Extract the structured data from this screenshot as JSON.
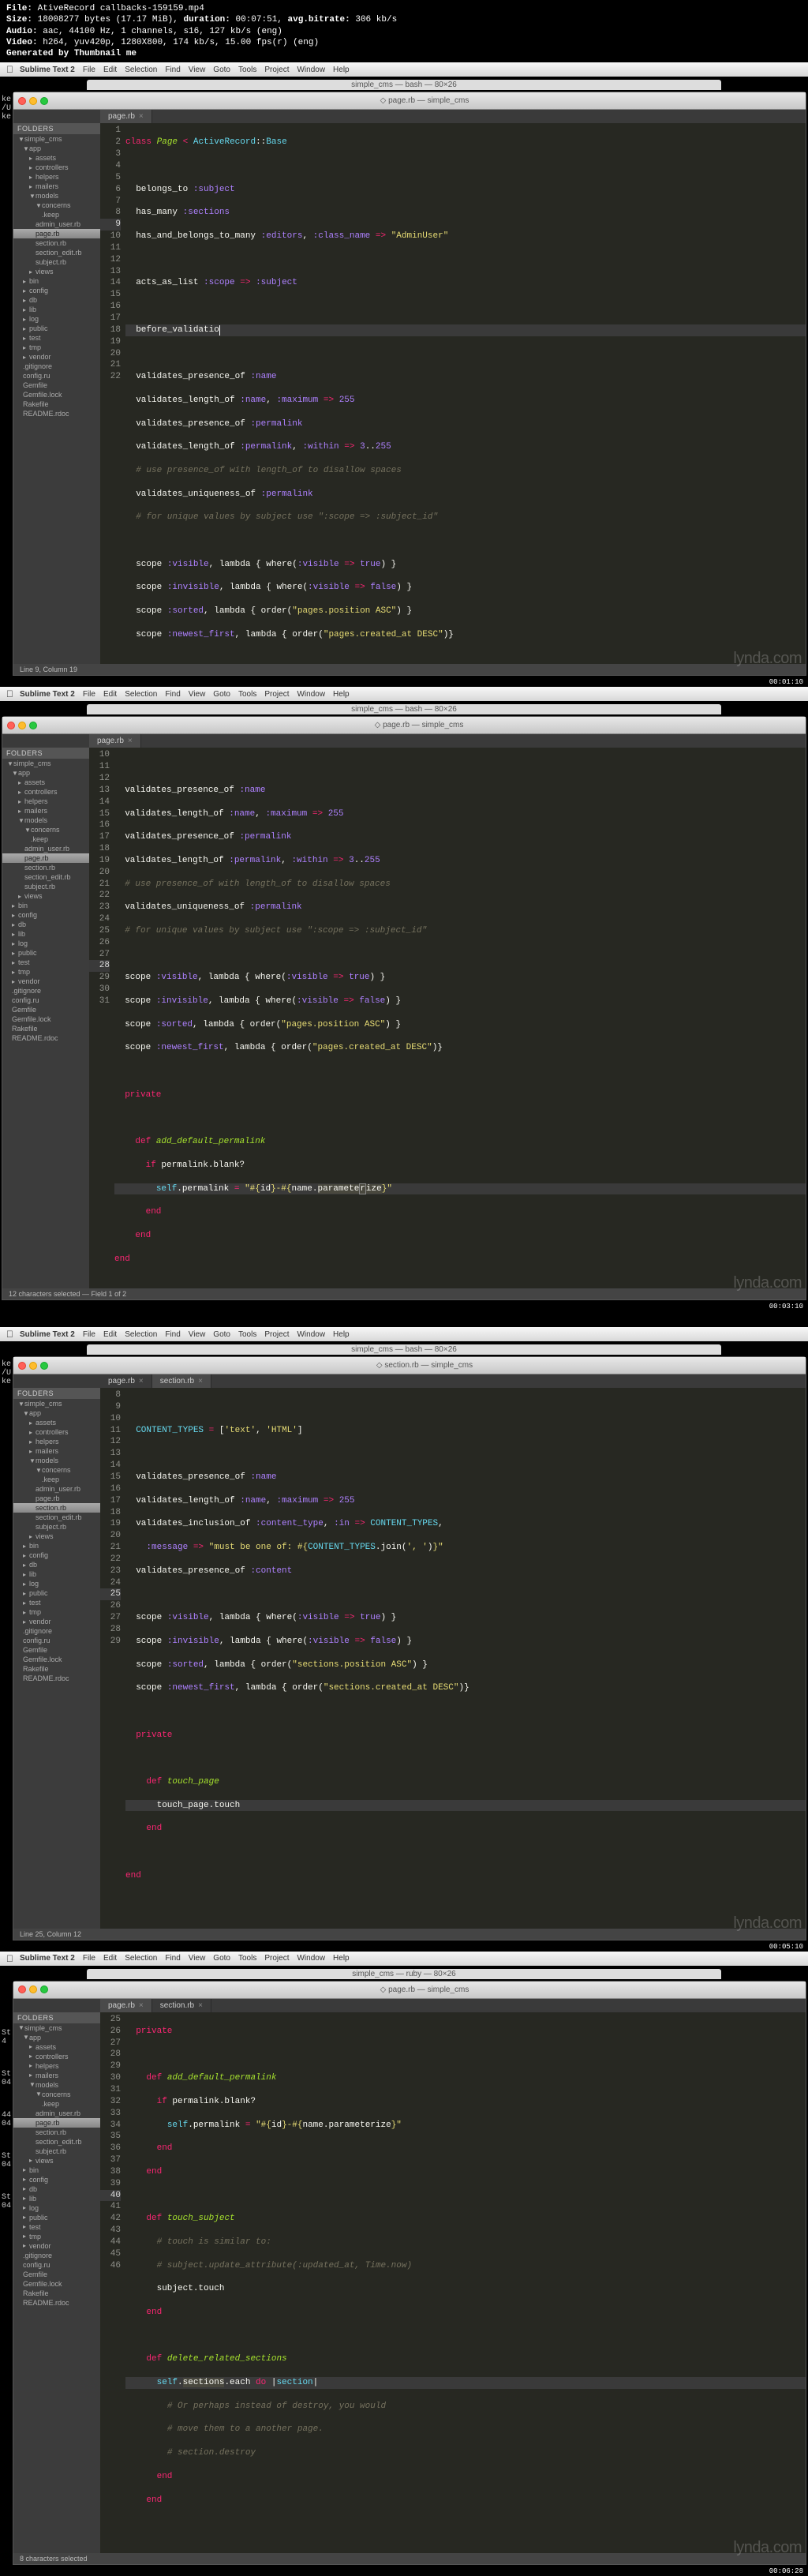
{
  "header": {
    "file_label": "File:",
    "file": "AtiveRecord callbacks-159159.mp4",
    "size_label": "Size:",
    "size": "18008277 bytes (17.17 MiB),",
    "dur_label": "duration:",
    "duration": "00:07:51,",
    "br_label": "avg.bitrate:",
    "bitrate": "306 kb/s",
    "audio_label": "Audio:",
    "audio": "aac, 44100 Hz, 1 channels, s16, 127 kb/s (eng)",
    "video_label": "Video:",
    "video": "h264, yuv420p, 1280X800, 174 kb/s, 15.00 fps(r) (eng)",
    "gen": "Generated by Thumbnail me"
  },
  "menubar": {
    "apple": "",
    "app": "Sublime Text 2",
    "items": [
      "File",
      "Edit",
      "Selection",
      "Find",
      "View",
      "Goto",
      "Tools",
      "Project",
      "Window",
      "Help"
    ]
  },
  "term_titles": {
    "t1": "simple_cms — bash — 80×26",
    "t2": "simple_cms — bash — 80×26",
    "t3": "simple_cms — bash — 80×26",
    "t4": "simple_cms — ruby — 80×26"
  },
  "tabs": {
    "page": "page.rb",
    "section": "section.rb",
    "sub": "— simple_cms"
  },
  "sidebar": {
    "header": "FOLDERS",
    "root": "simple_cms",
    "app": "app",
    "assets": "assets",
    "controllers": "controllers",
    "helpers": "helpers",
    "mailers": "mailers",
    "models": "models",
    "concerns": "concerns",
    "keep": ".keep",
    "admin_user": "admin_user.rb",
    "page": "page.rb",
    "section": "section.rb",
    "section_edit": "section_edit.rb",
    "subject": "subject.rb",
    "views": "views",
    "bin": "bin",
    "config": "config",
    "db": "db",
    "lib": "lib",
    "log": "log",
    "public": "public",
    "test": "test",
    "tmp": "tmp",
    "vendor": "vendor",
    "gitignore": ".gitignore",
    "configru": "config.ru",
    "gemfile": "Gemfile",
    "gemfilelock": "Gemfile.lock",
    "rakefile": "Rakefile",
    "readme": "README.rdoc"
  },
  "status": {
    "s1": "Line 9, Column 19",
    "s2": "12 characters selected — Field 1 of 2",
    "s3": "Line 25, Column 12",
    "s4": "8 characters selected"
  },
  "timecodes": {
    "t1": "00:01:10",
    "t2": "00:03:10",
    "t3": "00:05:10",
    "t4": "00:06:28"
  },
  "watermark": "lynda.com",
  "bg_frag": {
    "f1a": "ke",
    "f1b": "/U",
    "f1c": "ke",
    "f3a": "ke",
    "f3b": "/U",
    "f3c": "ke",
    "f4a_l1": "St",
    "f4a_l2": "4",
    "f4b_l1": "St",
    "f4b_l2": "04",
    "f4c_l1": "44",
    "f4c_l2": "04",
    "f4d_l1": "St",
    "f4d_l2": "04",
    "f4e_l1": "St",
    "f4e_l2": "04"
  }
}
